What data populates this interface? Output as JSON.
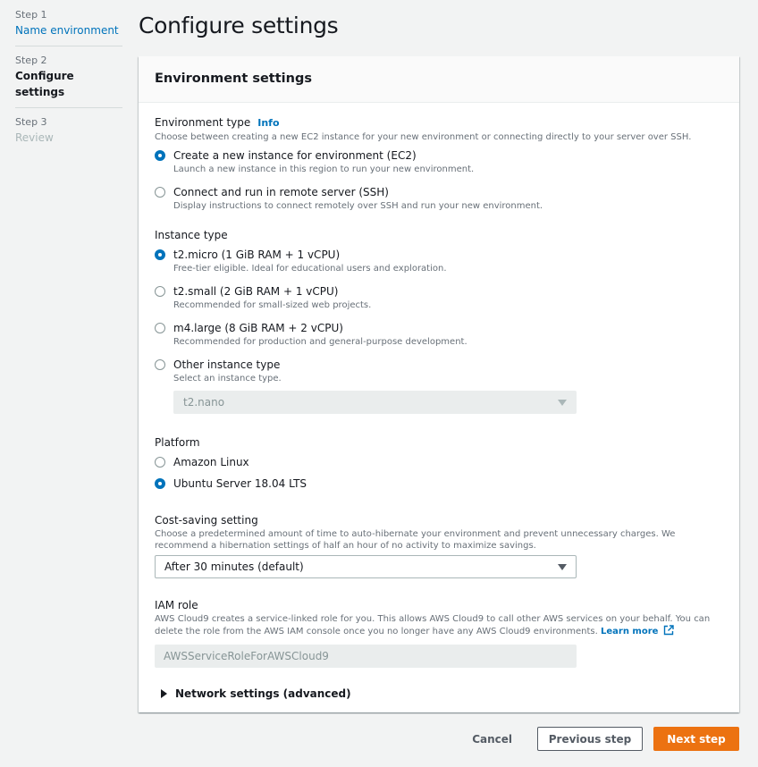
{
  "steps": [
    {
      "num": "Step 1",
      "name": "Name environment"
    },
    {
      "num": "Step 2",
      "name": "Configure settings"
    },
    {
      "num": "Step 3",
      "name": "Review"
    }
  ],
  "page_title": "Configure settings",
  "panel": {
    "title": "Environment settings",
    "environment_type": {
      "label": "Environment type",
      "info": "Info",
      "description": "Choose between creating a new EC2 instance for your new environment or connecting directly to your server over SSH.",
      "options": [
        {
          "label": "Create a new instance for environment (EC2)",
          "desc": "Launch a new instance in this region to run your new environment.",
          "selected": true
        },
        {
          "label": "Connect and run in remote server (SSH)",
          "desc": "Display instructions to connect remotely over SSH and run your new environment.",
          "selected": false
        }
      ]
    },
    "instance_type": {
      "label": "Instance type",
      "options": [
        {
          "label": "t2.micro (1 GiB RAM + 1 vCPU)",
          "desc": "Free-tier eligible. Ideal for educational users and exploration.",
          "selected": true
        },
        {
          "label": "t2.small (2 GiB RAM + 1 vCPU)",
          "desc": "Recommended for small-sized web projects.",
          "selected": false
        },
        {
          "label": "m4.large (8 GiB RAM + 2 vCPU)",
          "desc": "Recommended for production and general-purpose development.",
          "selected": false
        },
        {
          "label": "Other instance type",
          "desc": "Select an instance type.",
          "selected": false
        }
      ],
      "other_select_value": "t2.nano"
    },
    "platform": {
      "label": "Platform",
      "options": [
        {
          "label": "Amazon Linux",
          "selected": false
        },
        {
          "label": "Ubuntu Server 18.04 LTS",
          "selected": true
        }
      ]
    },
    "cost_saving": {
      "label": "Cost-saving setting",
      "description": "Choose a predetermined amount of time to auto-hibernate your environment and prevent unnecessary charges. We recommend a hibernation settings of half an hour of no activity to maximize savings.",
      "value": "After 30 minutes (default)"
    },
    "iam_role": {
      "label": "IAM role",
      "description": "AWS Cloud9 creates a service-linked role for you. This allows AWS Cloud9 to call other AWS services on your behalf. You can delete the role from the AWS IAM console once you no longer have any AWS Cloud9 environments.",
      "learn_more": "Learn more",
      "value": "AWSServiceRoleForAWSCloud9"
    },
    "network_settings": "Network settings (advanced)"
  },
  "footer": {
    "cancel": "Cancel",
    "previous": "Previous step",
    "next": "Next step"
  },
  "colors": {
    "accent": "#0073bb",
    "primary_button": "#ec7211",
    "background": "#f2f3f3"
  }
}
